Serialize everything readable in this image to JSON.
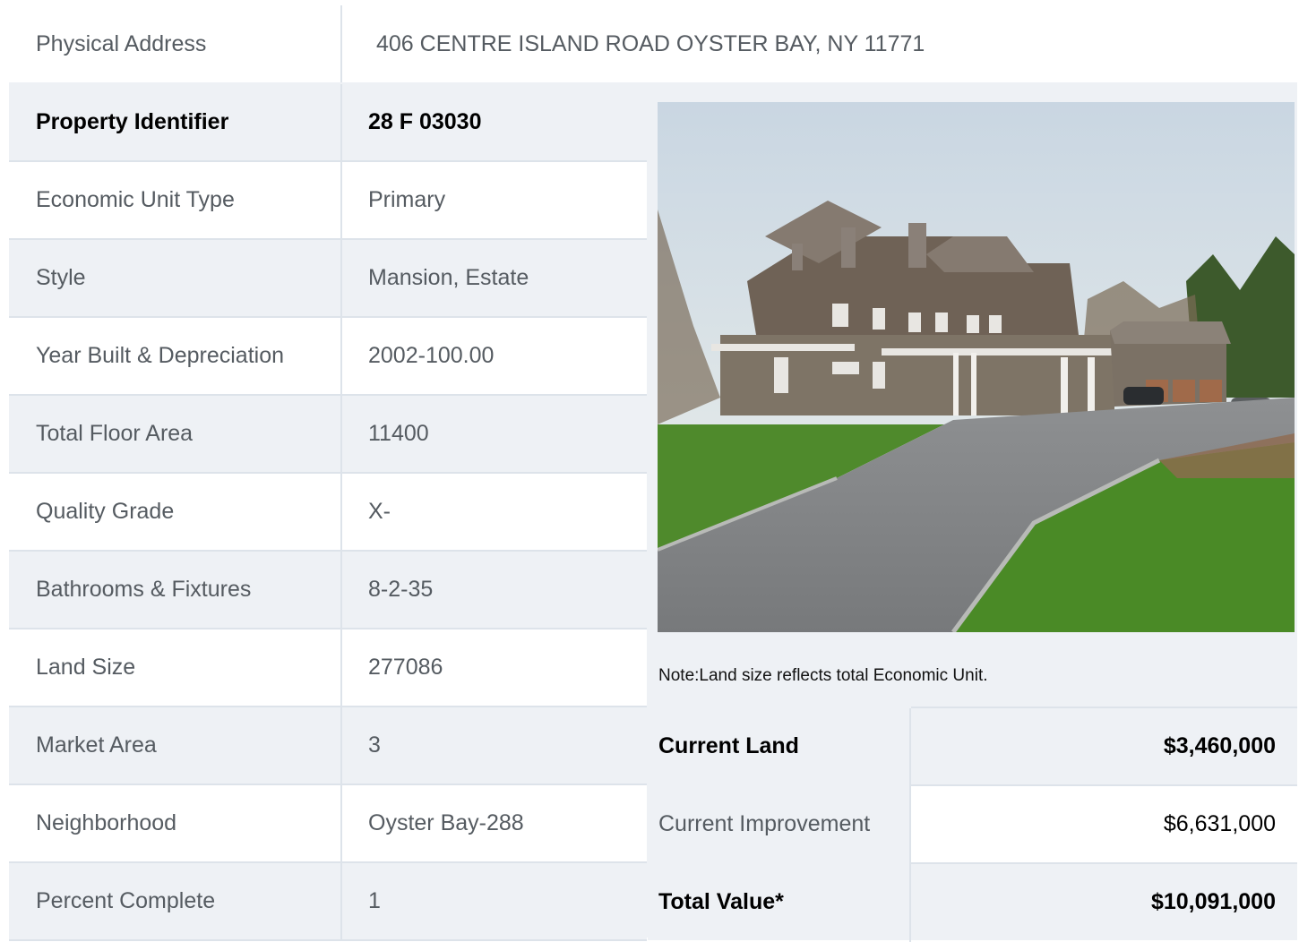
{
  "address": {
    "label": "Physical Address",
    "value": "406  CENTRE ISLAND ROAD   OYSTER BAY, NY  11771"
  },
  "details": [
    {
      "label": "Property Identifier",
      "value": "28  F  03030"
    },
    {
      "label": "Economic Unit Type",
      "value": "Primary"
    },
    {
      "label": "Style",
      "value": "Mansion, Estate"
    },
    {
      "label": "Year Built & Depreciation",
      "value": "2002-100.00"
    },
    {
      "label": "Total Floor Area",
      "value": "11400"
    },
    {
      "label": "Quality Grade",
      "value": "X-"
    },
    {
      "label": "Bathrooms & Fixtures",
      "value": "8-2-35"
    },
    {
      "label": "Land Size",
      "value": "277086"
    },
    {
      "label": "Market Area",
      "value": "3"
    },
    {
      "label": "Neighborhood",
      "value": "Oyster Bay-288"
    },
    {
      "label": "Percent Complete",
      "value": "1"
    }
  ],
  "note": "Note:Land size reflects total Economic Unit.",
  "values": [
    {
      "label": "Current Land",
      "value": "$3,460,000"
    },
    {
      "label": "Current Improvement",
      "value": "$6,631,000"
    },
    {
      "label": "Total Value*",
      "value": "$10,091,000"
    }
  ],
  "colors": {
    "row_alt": "#eef1f5",
    "row": "#ffffff",
    "border": "#dde3ea",
    "text": "#555b61"
  },
  "photo": {
    "subject": "house-photo"
  }
}
